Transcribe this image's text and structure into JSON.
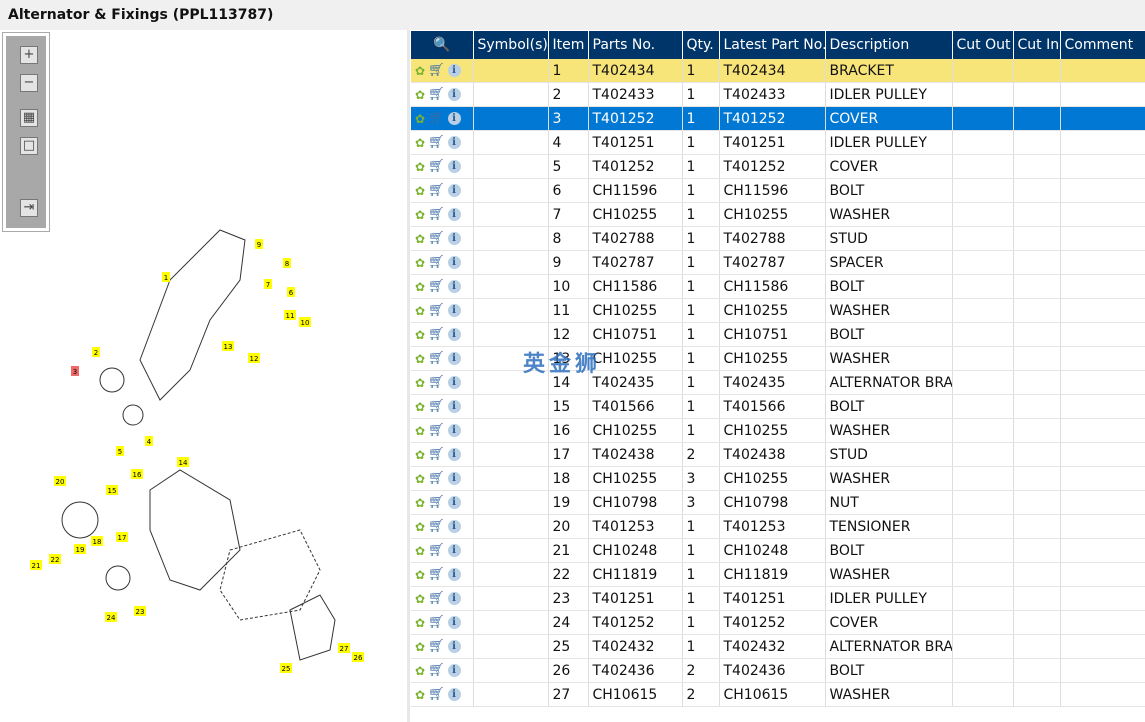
{
  "title": "Alternator & Fixings (PPL113787)",
  "watermark": "英金狮",
  "toolbar": {
    "zoom_in": "+",
    "zoom_out": "−",
    "fit": "▦",
    "actual": "□",
    "export": "⇥"
  },
  "columns": [
    "",
    "Symbol(s)",
    "Item",
    "Parts No.",
    "Qty.",
    "Latest Part No.",
    "Description",
    "Cut Out",
    "Cut In",
    "Comment"
  ],
  "rows": [
    [
      "1",
      "T402434",
      "1",
      "T402434",
      "BRACKET"
    ],
    [
      "2",
      "T402433",
      "1",
      "T402433",
      "IDLER PULLEY"
    ],
    [
      "3",
      "T401252",
      "1",
      "T401252",
      "COVER"
    ],
    [
      "4",
      "T401251",
      "1",
      "T401251",
      "IDLER PULLEY"
    ],
    [
      "5",
      "T401252",
      "1",
      "T401252",
      "COVER"
    ],
    [
      "6",
      "CH11596",
      "1",
      "CH11596",
      "BOLT"
    ],
    [
      "7",
      "CH10255",
      "1",
      "CH10255",
      "WASHER"
    ],
    [
      "8",
      "T402788",
      "1",
      "T402788",
      "STUD"
    ],
    [
      "9",
      "T402787",
      "1",
      "T402787",
      "SPACER"
    ],
    [
      "10",
      "CH11586",
      "1",
      "CH11586",
      "BOLT"
    ],
    [
      "11",
      "CH10255",
      "1",
      "CH10255",
      "WASHER"
    ],
    [
      "12",
      "CH10751",
      "1",
      "CH10751",
      "BOLT"
    ],
    [
      "13",
      "CH10255",
      "1",
      "CH10255",
      "WASHER"
    ],
    [
      "14",
      "T402435",
      "1",
      "T402435",
      "ALTERNATOR BRA"
    ],
    [
      "15",
      "T401566",
      "1",
      "T401566",
      "BOLT"
    ],
    [
      "16",
      "CH10255",
      "1",
      "CH10255",
      "WASHER"
    ],
    [
      "17",
      "T402438",
      "2",
      "T402438",
      "STUD"
    ],
    [
      "18",
      "CH10255",
      "3",
      "CH10255",
      "WASHER"
    ],
    [
      "19",
      "CH10798",
      "3",
      "CH10798",
      "NUT"
    ],
    [
      "20",
      "T401253",
      "1",
      "T401253",
      "TENSIONER"
    ],
    [
      "21",
      "CH10248",
      "1",
      "CH10248",
      "BOLT"
    ],
    [
      "22",
      "CH11819",
      "1",
      "CH11819",
      "WASHER"
    ],
    [
      "23",
      "T401251",
      "1",
      "T401251",
      "IDLER PULLEY"
    ],
    [
      "24",
      "T401252",
      "1",
      "T401252",
      "COVER"
    ],
    [
      "25",
      "T402432",
      "1",
      "T402432",
      "ALTERNATOR BRA"
    ],
    [
      "26",
      "T402436",
      "2",
      "T402436",
      "BOLT"
    ],
    [
      "27",
      "CH10615",
      "2",
      "CH10615",
      "WASHER"
    ]
  ],
  "callouts": [
    [
      "1",
      166,
      247
    ],
    [
      "2",
      96,
      322
    ],
    [
      "3",
      75,
      341
    ],
    [
      "4",
      149,
      411
    ],
    [
      "5",
      120,
      421
    ],
    [
      "6",
      291,
      262
    ],
    [
      "7",
      268,
      254
    ],
    [
      "8",
      287,
      233
    ],
    [
      "9",
      259,
      214
    ],
    [
      "10",
      303,
      292
    ],
    [
      "11",
      288,
      285
    ],
    [
      "12",
      252,
      328
    ],
    [
      "13",
      226,
      316
    ],
    [
      "14",
      181,
      432
    ],
    [
      "15",
      110,
      460
    ],
    [
      "16",
      135,
      444
    ],
    [
      "17",
      120,
      507
    ],
    [
      "18",
      95,
      511
    ],
    [
      "19",
      78,
      519
    ],
    [
      "20",
      58,
      451
    ],
    [
      "21",
      34,
      535
    ],
    [
      "22",
      53,
      529
    ],
    [
      "23",
      138,
      581
    ],
    [
      "24",
      109,
      587
    ],
    [
      "25",
      284,
      638
    ],
    [
      "26",
      356,
      627
    ],
    [
      "27",
      342,
      618
    ]
  ],
  "colors": {
    "header": "#00356a",
    "selected": "#0078d4",
    "highlight": "#f8e57a",
    "callout": "#ffff00",
    "callout_selected": "#f06a6a"
  }
}
